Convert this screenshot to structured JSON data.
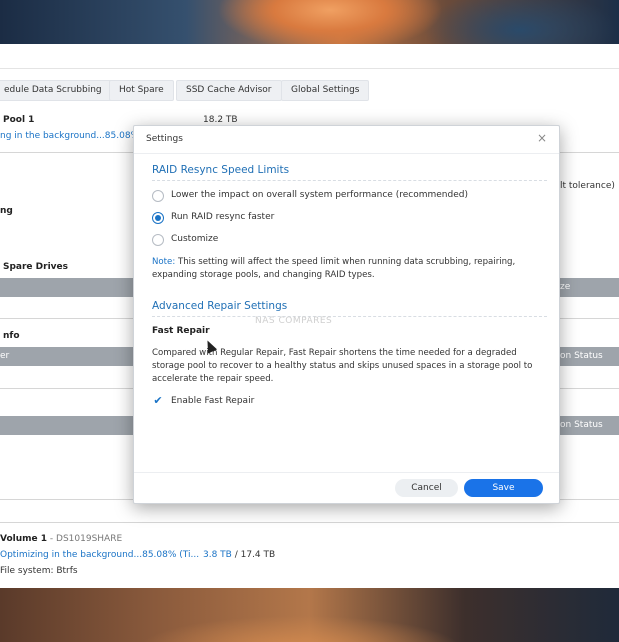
{
  "toolbar": {
    "buttons": [
      "edule Data Scrubbing",
      "Hot Spare",
      "SSD Cache Advisor",
      "Global Settings"
    ]
  },
  "background": {
    "pool_title": "Pool 1",
    "pool_status": "ng in the background...85.08%",
    "pool_size": "18.2 TB",
    "tolerance_text": "lt tolerance)",
    "left_ng": "ng",
    "spare_drives": "Spare Drives",
    "size_header": "ze",
    "info_label": "nfo",
    "er_label": "er",
    "status_header_1": "on Status",
    "status_header_2": "on Status",
    "volume_title": "Volume 1",
    "volume_sep": " - ",
    "volume_host": "DS1019SHARE",
    "volume_status": "Optimizing in the background...85.08% (Ti...",
    "volume_used": "3.8 TB",
    "volume_total": " / 17.4 TB",
    "volume_usage_fraction": 0.22,
    "file_system": "File system: Btrfs"
  },
  "dialog": {
    "title": "Settings",
    "close_glyph": "×",
    "resync_section": "RAID Resync Speed Limits",
    "options": [
      "Lower the impact on overall system performance (recommended)",
      "Run RAID resync faster",
      "Customize"
    ],
    "selected_option_index": 1,
    "note_label": "Note:",
    "note_text": " This setting will affect the speed limit when running data scrubbing, repairing, expanding storage pools, and changing RAID types.",
    "repair_section": "Advanced Repair Settings",
    "fast_repair_title": "Fast Repair",
    "fast_repair_desc": "Compared with Regular Repair, Fast Repair shortens the time needed for a degraded storage pool to recover to a healthy status and skips unused spaces in a storage pool to accelerate the repair speed.",
    "enable_fast_repair_label": "Enable Fast Repair",
    "enable_fast_repair_checked": true,
    "cancel_label": "Cancel",
    "save_label": "Save",
    "watermark": "NAS COMPARES"
  },
  "colors": {
    "accent": "#1a73c6",
    "save_button": "#1a73e8",
    "header_bar": "#9ea4ab"
  }
}
